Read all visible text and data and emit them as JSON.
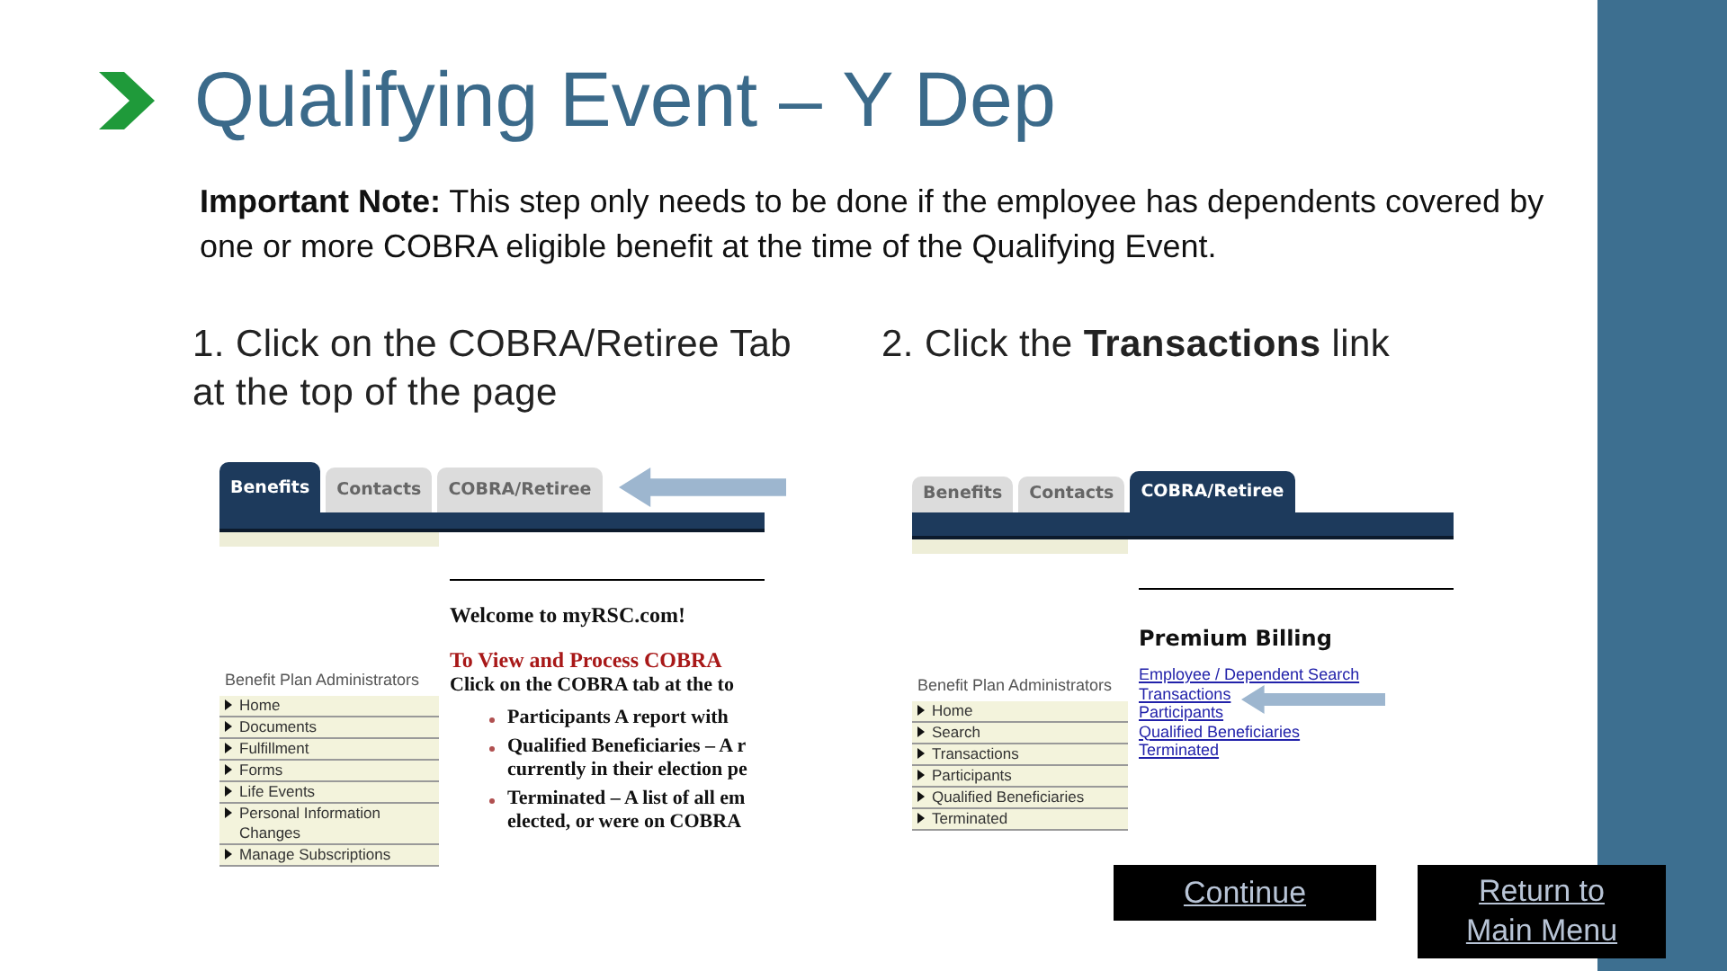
{
  "title": "Qualifying Event – Y Dep",
  "note": "**Important Note:** This step only needs to be done if the employee has dependents covered by one or more COBRA eligible benefit at the time of the Qualifying Event.",
  "steps": [
    {
      "text": "1. Click on the COBRA/Retiree Tab at the top of the page",
      "screen": {
        "kind": "welcome",
        "tabs": [
          {
            "label": "Benefits",
            "selected": true
          },
          {
            "label": "Contacts",
            "selected": false
          },
          {
            "label": "COBRA/Retiree",
            "selected": false
          }
        ],
        "sidebar_title": "Benefit Plan Administrators",
        "sidebar_items": [
          "Home",
          "Documents",
          "Fulfillment",
          "Forms",
          "Life Events",
          "Personal Information Changes",
          "Manage Subscriptions"
        ],
        "heading": "Welcome to myRSC.com!",
        "subheading": "To View and Process COBRA",
        "intro": "Click on the COBRA tab at the to",
        "bullets": [
          {
            "lines": [
              "Participants   A report with"
            ]
          },
          {
            "lines": [
              "Qualified Beneficiaries – A r",
              "currently in their election pe"
            ]
          },
          {
            "lines": [
              "Terminated – A list of all em",
              "elected, or were on COBRA"
            ]
          }
        ]
      }
    },
    {
      "text": "2.  Click the **Transactions** link",
      "screen": {
        "kind": "links",
        "tabs": [
          {
            "label": "Benefits",
            "selected": false
          },
          {
            "label": "Contacts",
            "selected": false
          },
          {
            "label": "COBRA/Retiree",
            "selected": true
          }
        ],
        "sidebar_title": "Benefit Plan Administrators",
        "sidebar_items": [
          "Home",
          "Search",
          "Transactions",
          "Participants",
          "Qualified Beneficiaries",
          "Terminated"
        ],
        "heading": "Premium Billing",
        "links": [
          "Employee / Dependent Search",
          "Transactions",
          "Participants",
          "Qualified Beneficiaries",
          "Terminated"
        ]
      }
    }
  ],
  "buttons": [
    "Continue",
    "Return to Main Menu"
  ]
}
